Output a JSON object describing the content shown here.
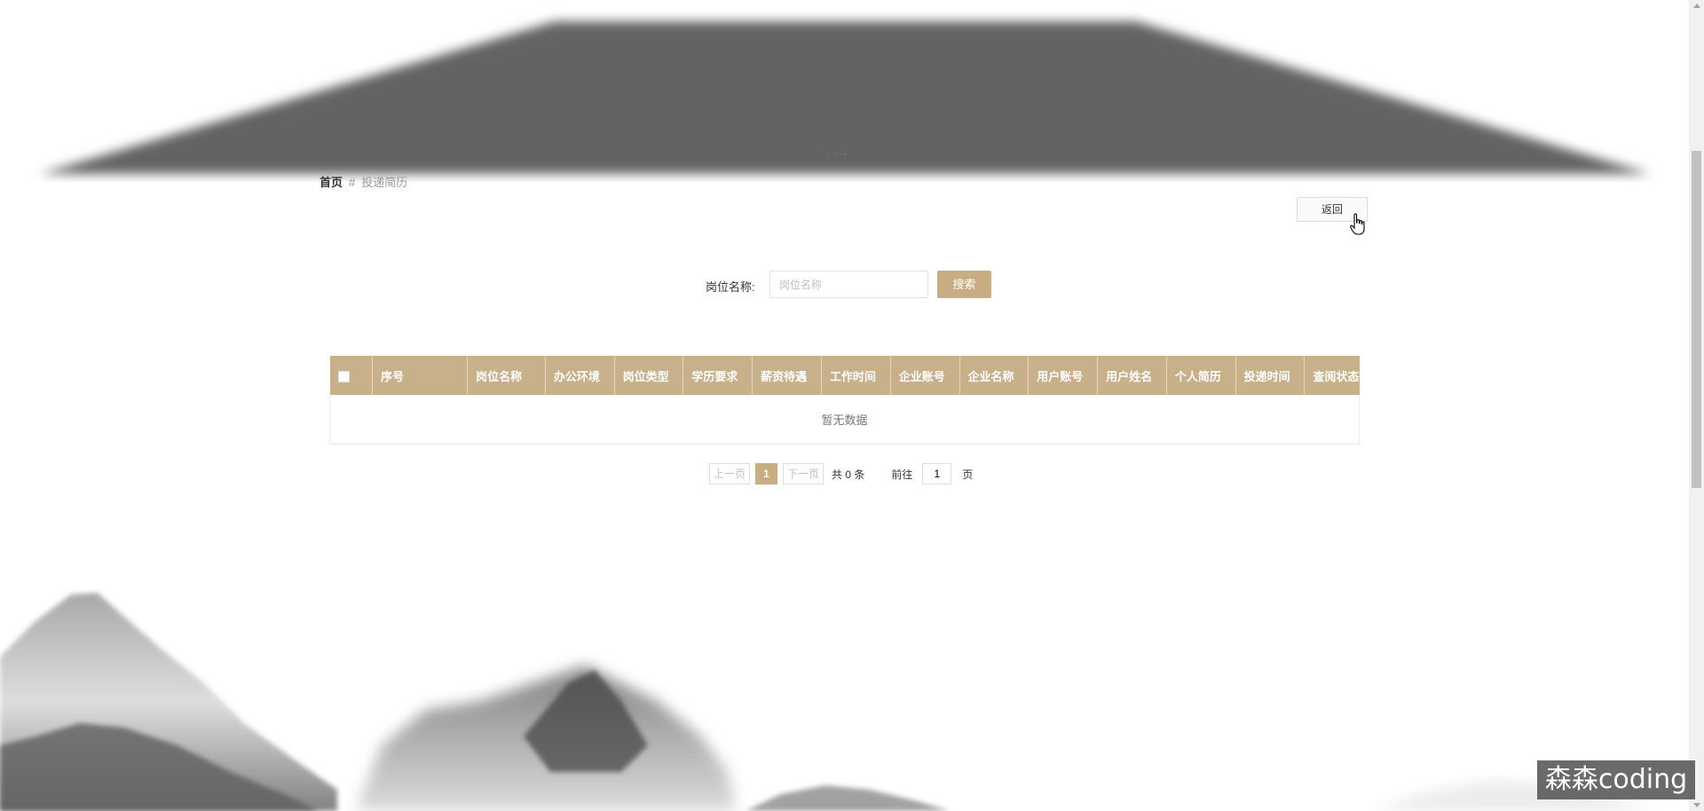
{
  "breadcrumb": {
    "home": "首页",
    "separator": "#",
    "current": "投递简历"
  },
  "back_button": "返回",
  "search": {
    "label": "岗位名称:",
    "placeholder": "岗位名称",
    "button": "搜索"
  },
  "table": {
    "columns": [
      "序号",
      "岗位名称",
      "办公环境",
      "岗位类型",
      "学历要求",
      "薪资待遇",
      "工作时间",
      "企业账号",
      "企业名称",
      "用户账号",
      "用户姓名",
      "个人简历",
      "投递时间",
      "查阅状态"
    ],
    "empty_text": "暂无数据"
  },
  "pagination": {
    "prev": "上一页",
    "current_page": "1",
    "next": "下一页",
    "total": "共 0 条",
    "goto_label": "前往",
    "goto_value": "1",
    "page_suffix": "页"
  },
  "watermark": "森森coding",
  "colors": {
    "accent": "#c8ad83",
    "table_header": "#c8b08a",
    "banner": "#646464"
  }
}
